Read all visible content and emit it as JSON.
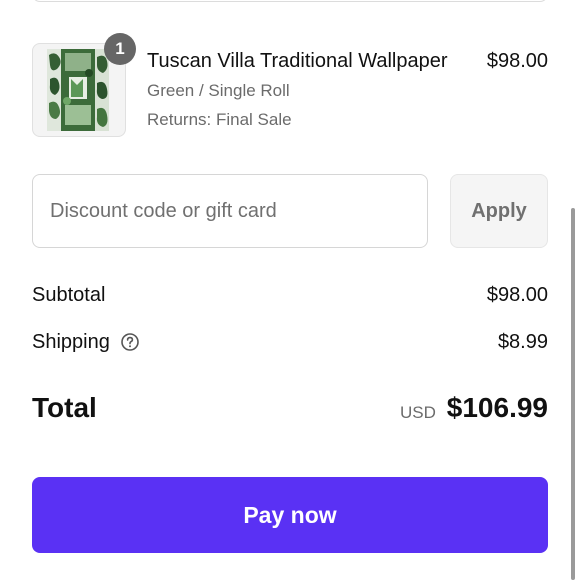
{
  "cart_item": {
    "quantity": "1",
    "title": "Tuscan Villa Traditional Wallpaper",
    "variant": "Green / Single Roll",
    "returns": "Returns: Final Sale",
    "price": "$98.00",
    "thumbnail_icon": "wallpaper-swatch-image"
  },
  "discount": {
    "placeholder": "Discount code or gift card",
    "value": "",
    "apply_label": "Apply"
  },
  "summary": {
    "subtotal_label": "Subtotal",
    "subtotal_value": "$98.00",
    "shipping_label": "Shipping",
    "shipping_help_icon": "question-circle-icon",
    "shipping_value": "$8.99",
    "total_label": "Total",
    "currency": "USD",
    "total_value": "$106.99"
  },
  "checkout": {
    "pay_label": "Pay now",
    "accent_color": "#5a31f4"
  }
}
